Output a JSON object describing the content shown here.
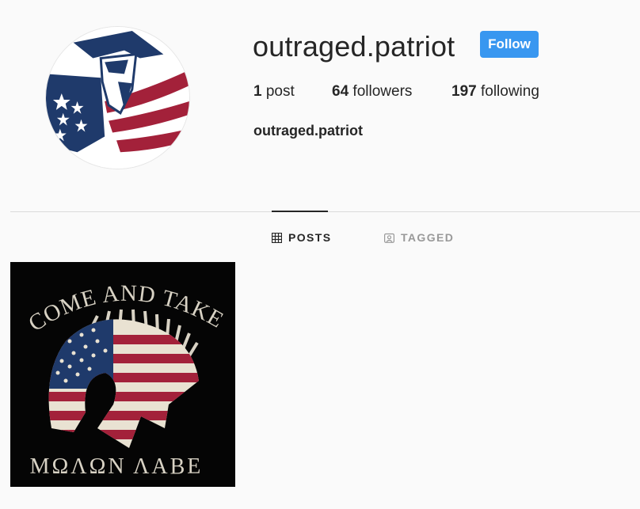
{
  "profile": {
    "username": "outraged.patriot",
    "full_name": "outraged.patriot",
    "follow_label": "Follow",
    "stats": {
      "posts_count": "1",
      "posts_label": "post",
      "followers_count": "64",
      "followers_label": "followers",
      "following_count": "197",
      "following_label": "following"
    }
  },
  "tabs": [
    {
      "label": "POSTS",
      "icon": "grid-icon",
      "active": true
    },
    {
      "label": "TAGGED",
      "icon": "tagged-icon",
      "active": false
    }
  ],
  "posts": [
    {
      "image_top_text": "COME AND TAKE",
      "image_bottom_text": "ΜΩΛΩΝ ΛΑΒΕ",
      "image_subject": "spartan-helmet-flag"
    }
  ],
  "colors": {
    "accent": "#3897f0",
    "text": "#262626",
    "muted": "#999999",
    "background": "#fafafa",
    "divider": "#dbdbdb",
    "flag_red": "#a3213a",
    "flag_blue": "#1f3a6b"
  }
}
